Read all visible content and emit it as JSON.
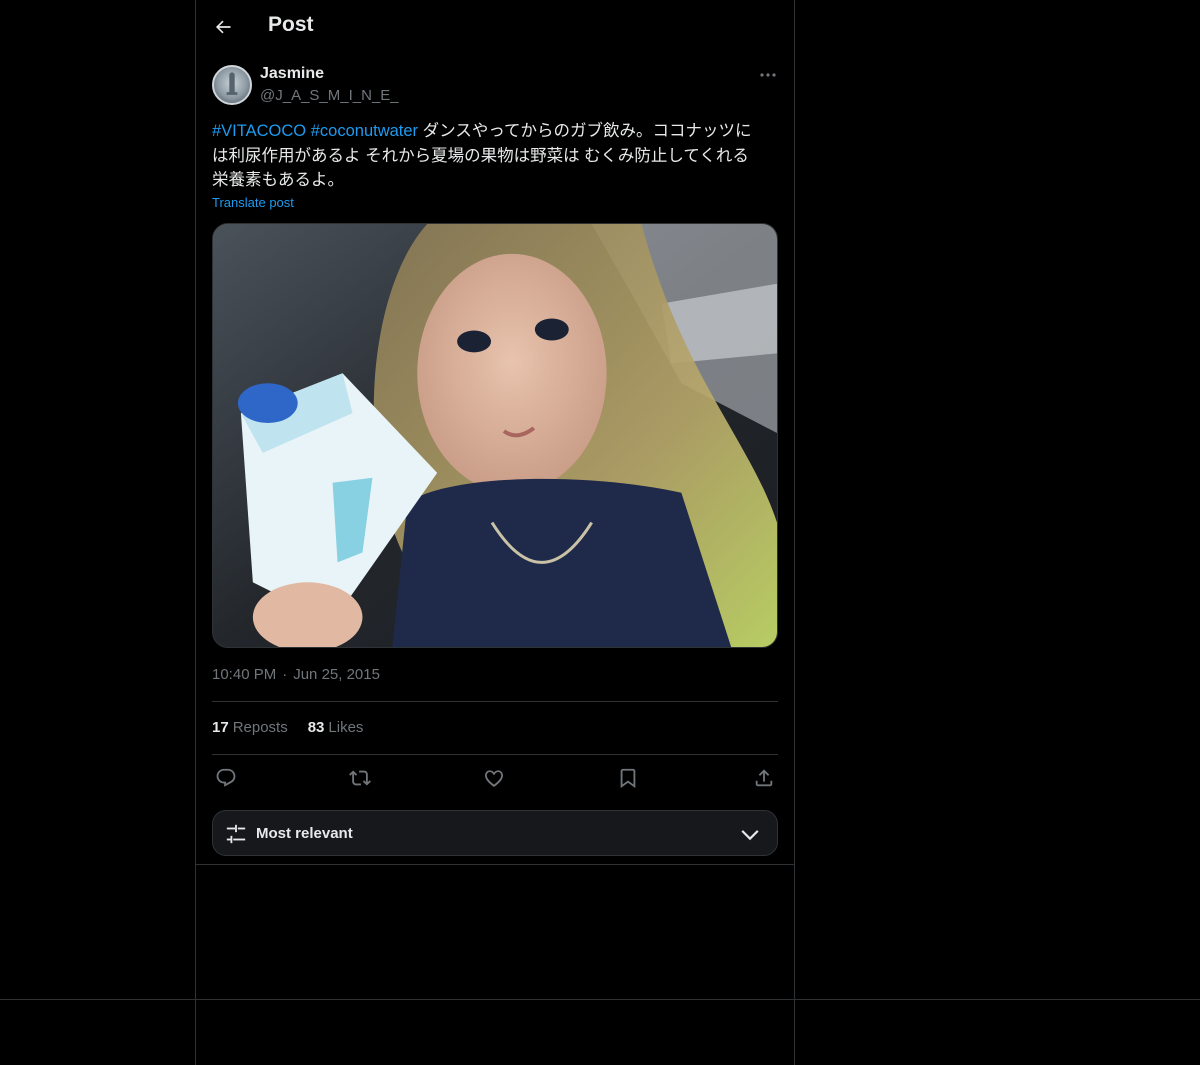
{
  "header": {
    "title": "Post"
  },
  "author": {
    "name": "Jasmine",
    "handle": "@J_A_S_M_I_N_E_"
  },
  "post": {
    "hashtags": [
      "#VITACOCO",
      "#coconutwater"
    ],
    "text_line1": "ダンスやってからのガブ飲み。ココナッツに",
    "text_line2": "は利尿作用があるよ それから夏場の果物は野菜は むくみ防止してくれる",
    "text_line3": "栄養素もあるよ。",
    "translate_label": "Translate post",
    "time": "10:40 PM",
    "separator": "·",
    "date": "Jun 25, 2015"
  },
  "stats": {
    "reposts_count": "17",
    "reposts_label": "Reposts",
    "likes_count": "83",
    "likes_label": "Likes"
  },
  "actions": [
    "reply-icon",
    "repost-icon",
    "like-icon",
    "bookmark-icon",
    "share-icon"
  ],
  "sort": {
    "label": "Most relevant"
  },
  "colors": {
    "accent": "#1d9bf0",
    "background": "#000000",
    "border": "#2f3336",
    "muted": "#71767b"
  }
}
